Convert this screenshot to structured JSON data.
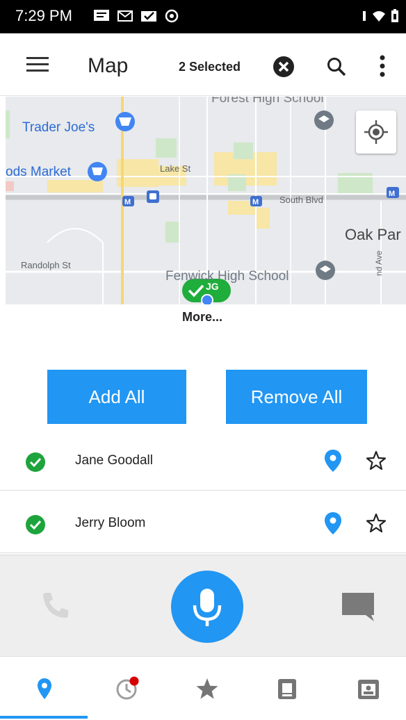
{
  "status_bar": {
    "time": "7:29 PM",
    "left_icons": [
      "message-icon",
      "gmail-icon",
      "mail-check-icon",
      "sync-icon"
    ],
    "right_icons": [
      "vibrate-icon",
      "wifi-icon",
      "battery-icon"
    ]
  },
  "toolbar": {
    "title": "Map",
    "selected_text": "2 Selected"
  },
  "map": {
    "labels": {
      "forest_high_school": "Forest High School",
      "trader_joes": "Trader Joe's",
      "whole_foods": "ods Market",
      "lake_st": "Lake St",
      "south_blvd": "South Blvd",
      "oak_park": "Oak Par",
      "randolph_st": "Randolph St",
      "fenwick_high_school": "Fenwick High School",
      "ridgeland_ave": "nd Ave"
    },
    "marker": {
      "initials": "JG"
    },
    "colors": {
      "pin_blue": "#4285f4",
      "school_gray": "#6f7a85",
      "marker_green": "#1fad3b"
    }
  },
  "more_label": "More...",
  "actions": {
    "add_all": "Add All",
    "remove_all": "Remove All"
  },
  "contacts": [
    {
      "name": "Jane Goodall",
      "selected": true,
      "starred": false
    },
    {
      "name": "Jerry Bloom",
      "selected": true,
      "starred": false
    }
  ],
  "call_panel": {
    "icons": [
      "phone-icon",
      "microphone-icon",
      "chat-icon"
    ]
  },
  "bottom_nav": {
    "items": [
      "map-pin-icon",
      "history-icon",
      "star-icon",
      "contacts-book-icon",
      "contact-card-icon"
    ],
    "active_index": 0,
    "history_has_badge": true
  },
  "colors": {
    "accent": "#2196f3",
    "check_green": "#1ea43c",
    "badge_red": "#d50000"
  }
}
